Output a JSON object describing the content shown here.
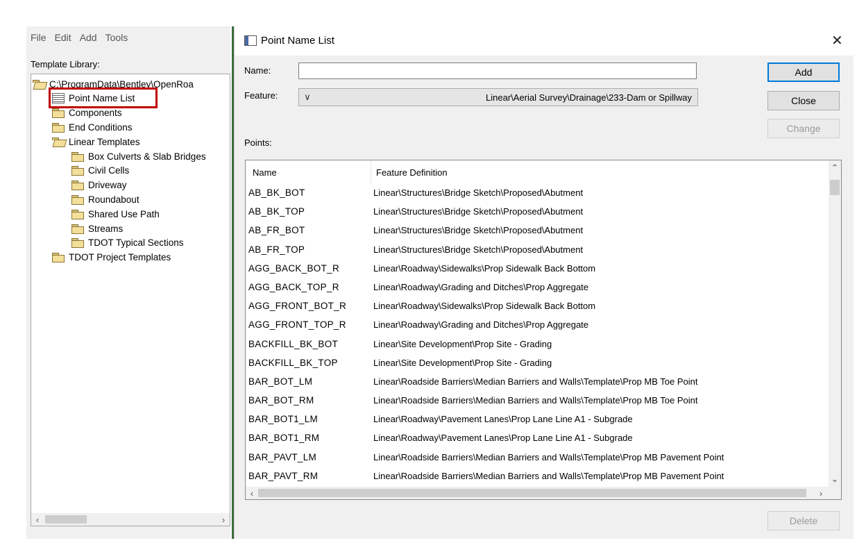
{
  "left_panel": {
    "menu": [
      "File",
      "Edit",
      "Add",
      "Tools"
    ],
    "library_label": "Template Library:",
    "tree": [
      {
        "label": "C:\\ProgramData\\Bentley\\OpenRoa",
        "icon": "folder-open-icon",
        "indent": 0
      },
      {
        "label": "Point Name List",
        "icon": "list-icon",
        "indent": 1
      },
      {
        "label": "Components",
        "icon": "folder-icon",
        "indent": 1
      },
      {
        "label": "End Conditions",
        "icon": "folder-icon",
        "indent": 1
      },
      {
        "label": "Linear Templates",
        "icon": "folder-open-icon",
        "indent": 1
      },
      {
        "label": "Box Culverts & Slab Bridges",
        "icon": "folder-icon",
        "indent": 2
      },
      {
        "label": "Civil Cells",
        "icon": "folder-icon",
        "indent": 2
      },
      {
        "label": "Driveway",
        "icon": "folder-icon",
        "indent": 2
      },
      {
        "label": "Roundabout",
        "icon": "folder-icon",
        "indent": 2
      },
      {
        "label": "Shared Use Path",
        "icon": "folder-icon",
        "indent": 2
      },
      {
        "label": "Streams",
        "icon": "folder-icon",
        "indent": 2
      },
      {
        "label": "TDOT Typical Sections",
        "icon": "folder-icon",
        "indent": 2
      },
      {
        "label": "TDOT Project Templates",
        "icon": "folder-icon",
        "indent": 1
      }
    ]
  },
  "dialog": {
    "title": "Point Name List",
    "name_label": "Name:",
    "name_value": "",
    "feature_label": "Feature:",
    "feature_value": "Linear\\Aerial Survey\\Drainage\\233-Dam or Spillway",
    "points_label": "Points:",
    "buttons": {
      "add": "Add",
      "close": "Close",
      "change": "Change",
      "delete": "Delete"
    },
    "columns": {
      "name": "Name",
      "feature": "Feature Definition"
    },
    "rows": [
      {
        "name": "AB_BK_BOT",
        "feature": "Linear\\Structures\\Bridge Sketch\\Proposed\\Abutment"
      },
      {
        "name": "AB_BK_TOP",
        "feature": "Linear\\Structures\\Bridge Sketch\\Proposed\\Abutment"
      },
      {
        "name": "AB_FR_BOT",
        "feature": "Linear\\Structures\\Bridge Sketch\\Proposed\\Abutment"
      },
      {
        "name": "AB_FR_TOP",
        "feature": "Linear\\Structures\\Bridge Sketch\\Proposed\\Abutment"
      },
      {
        "name": "AGG_BACK_BOT_R",
        "feature": "Linear\\Roadway\\Sidewalks\\Prop Sidewalk Back Bottom"
      },
      {
        "name": "AGG_BACK_TOP_R",
        "feature": "Linear\\Roadway\\Grading and Ditches\\Prop Aggregate"
      },
      {
        "name": "AGG_FRONT_BOT_R",
        "feature": "Linear\\Roadway\\Sidewalks\\Prop Sidewalk Back Bottom"
      },
      {
        "name": "AGG_FRONT_TOP_R",
        "feature": "Linear\\Roadway\\Grading and Ditches\\Prop Aggregate"
      },
      {
        "name": "BACKFILL_BK_BOT",
        "feature": "Linear\\Site Development\\Prop Site - Grading"
      },
      {
        "name": "BACKFILL_BK_TOP",
        "feature": "Linear\\Site Development\\Prop Site - Grading"
      },
      {
        "name": "BAR_BOT_LM",
        "feature": "Linear\\Roadside Barriers\\Median Barriers and Walls\\Template\\Prop MB Toe Point"
      },
      {
        "name": "BAR_BOT_RM",
        "feature": "Linear\\Roadside Barriers\\Median Barriers and Walls\\Template\\Prop MB Toe Point"
      },
      {
        "name": "BAR_BOT1_LM",
        "feature": "Linear\\Roadway\\Pavement Lanes\\Prop Lane Line A1 - Subgrade"
      },
      {
        "name": "BAR_BOT1_RM",
        "feature": "Linear\\Roadway\\Pavement Lanes\\Prop Lane Line A1 - Subgrade"
      },
      {
        "name": "BAR_PAVT_LM",
        "feature": "Linear\\Roadside Barriers\\Median Barriers and Walls\\Template\\Prop MB Pavement Point"
      },
      {
        "name": "BAR_PAVT_RM",
        "feature": "Linear\\Roadside Barriers\\Median Barriers and Walls\\Template\\Prop MB Pavement Point"
      }
    ]
  }
}
